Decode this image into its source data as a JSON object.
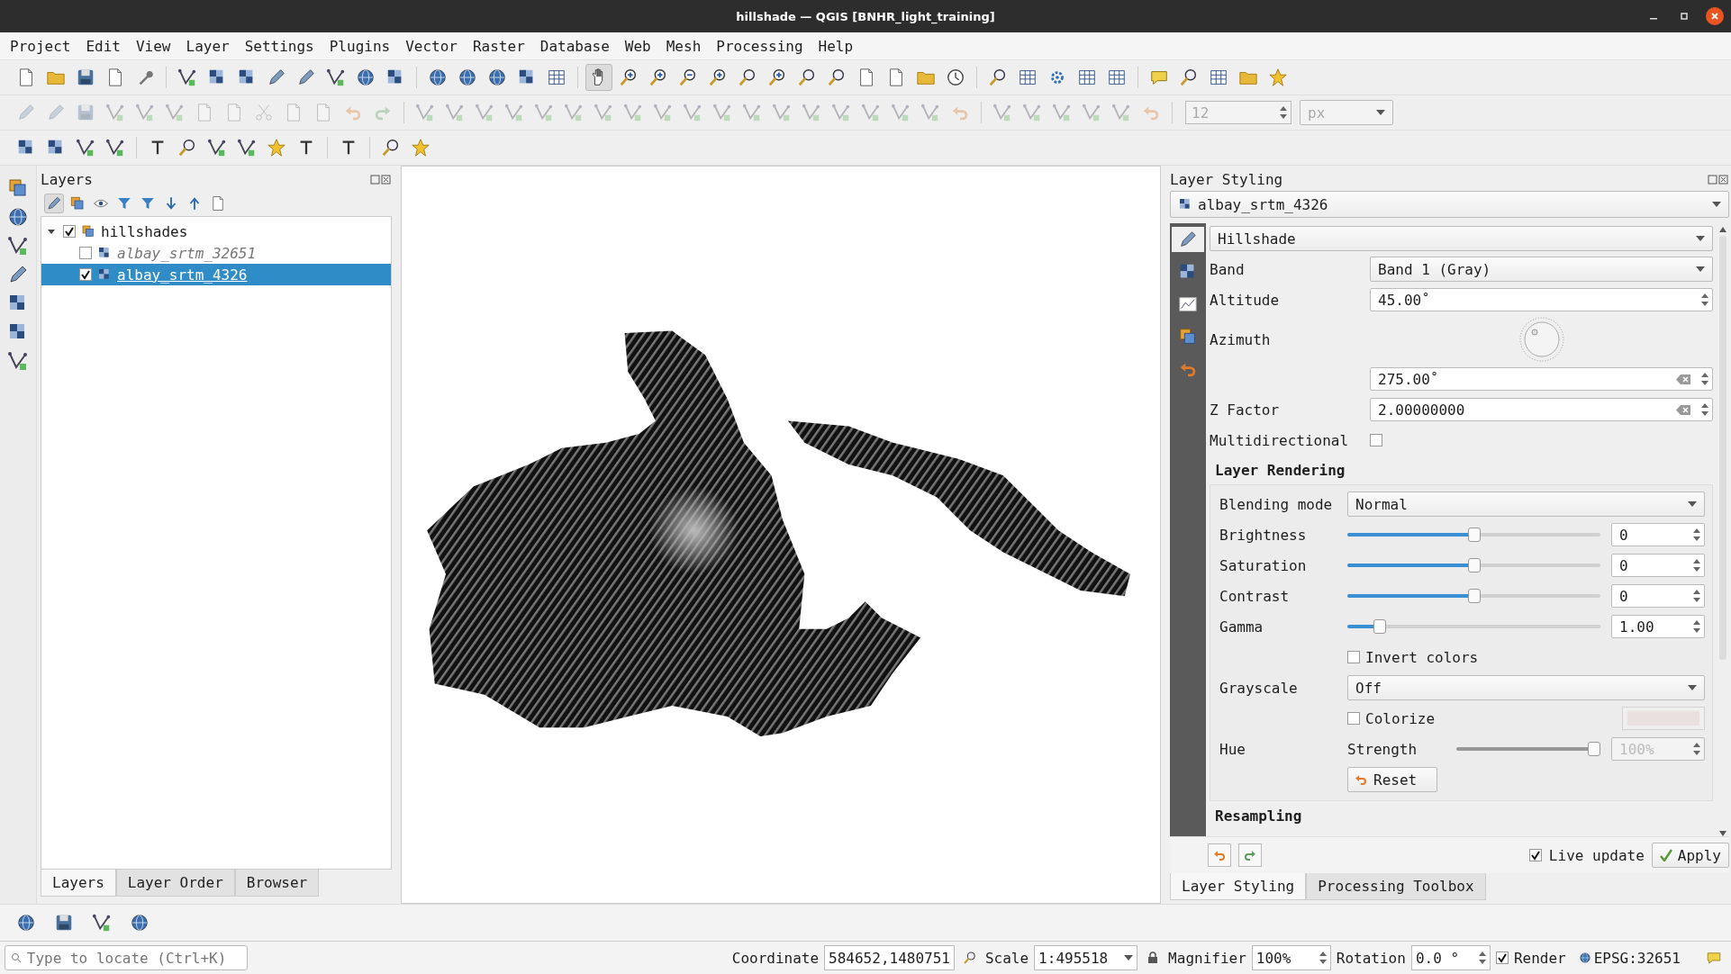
{
  "window": {
    "title": "hillshade — QGIS [BNHR_light_training]"
  },
  "menu": [
    "Project",
    "Edit",
    "View",
    "Layer",
    "Settings",
    "Plugins",
    "Vector",
    "Raster",
    "Database",
    "Web",
    "Mesh",
    "Processing",
    "Help"
  ],
  "toolbar_2": {
    "font_size": {
      "value": "12",
      "disabled": true
    },
    "unit": {
      "value": "px",
      "disabled": true
    }
  },
  "layers_panel": {
    "title": "Layers",
    "tree": [
      {
        "label": "hillshades",
        "kind": "group",
        "checked": true,
        "expanded": true,
        "selected": false,
        "children": [
          {
            "label": "albay_srtm_32651",
            "kind": "raster",
            "checked": false,
            "selected": false
          },
          {
            "label": "albay_srtm_4326",
            "kind": "raster",
            "checked": true,
            "selected": true
          }
        ]
      }
    ],
    "tabs": [
      {
        "label": "Layers",
        "selected": true
      },
      {
        "label": "Layer Order",
        "selected": false
      },
      {
        "label": "Browser",
        "selected": false
      }
    ]
  },
  "styling_panel": {
    "title": "Layer Styling",
    "layer": "albay_srtm_4326",
    "renderer": "Hillshade",
    "band": {
      "label": "Band",
      "value": "Band 1 (Gray)"
    },
    "altitude": {
      "label": "Altitude",
      "value": "45.00˚"
    },
    "azimuth": {
      "label": "Azimuth",
      "value": "275.00˚"
    },
    "z_factor": {
      "label": "Z Factor",
      "value": "2.00000000"
    },
    "multidirectional": {
      "label": "Multidirectional",
      "checked": false
    },
    "rendering": {
      "title": "Layer Rendering",
      "blending": {
        "label": "Blending mode",
        "value": "Normal"
      },
      "sliders": [
        {
          "label": "Brightness",
          "level": 0.5,
          "value": "0"
        },
        {
          "label": "Saturation",
          "level": 0.5,
          "value": "0"
        },
        {
          "label": "Contrast",
          "level": 0.5,
          "value": "0"
        },
        {
          "label": "Gamma",
          "level": 0.11,
          "value": "1.00"
        }
      ],
      "invert": {
        "label": "Invert colors",
        "checked": false
      },
      "grayscale": {
        "label": "Grayscale",
        "value": "Off"
      },
      "hue": {
        "label": "Hue",
        "colorize": {
          "label": "Colorize",
          "checked": false
        },
        "strength": {
          "label": "Strength",
          "level": 1.0,
          "value": "100%",
          "disabled": true
        }
      },
      "reset": "Reset"
    },
    "resampling": "Resampling",
    "live_update": {
      "label": "Live update",
      "checked": true
    },
    "apply": "Apply",
    "tabs": [
      {
        "label": "Layer Styling",
        "selected": true
      },
      {
        "label": "Processing Toolbox",
        "selected": false
      }
    ]
  },
  "status_bar": {
    "locate_placeholder": "Type to locate (Ctrl+K)",
    "coordinate_label": "Coordinate",
    "coordinate": "584652,1480751",
    "scale_label": "Scale",
    "scale": "1:495518",
    "magnifier_label": "Magnifier",
    "magnifier": "100%",
    "rotation_label": "Rotation",
    "rotation": "0.0 °",
    "render": {
      "label": "Render",
      "checked": true
    },
    "crs": "EPSG:32651"
  }
}
